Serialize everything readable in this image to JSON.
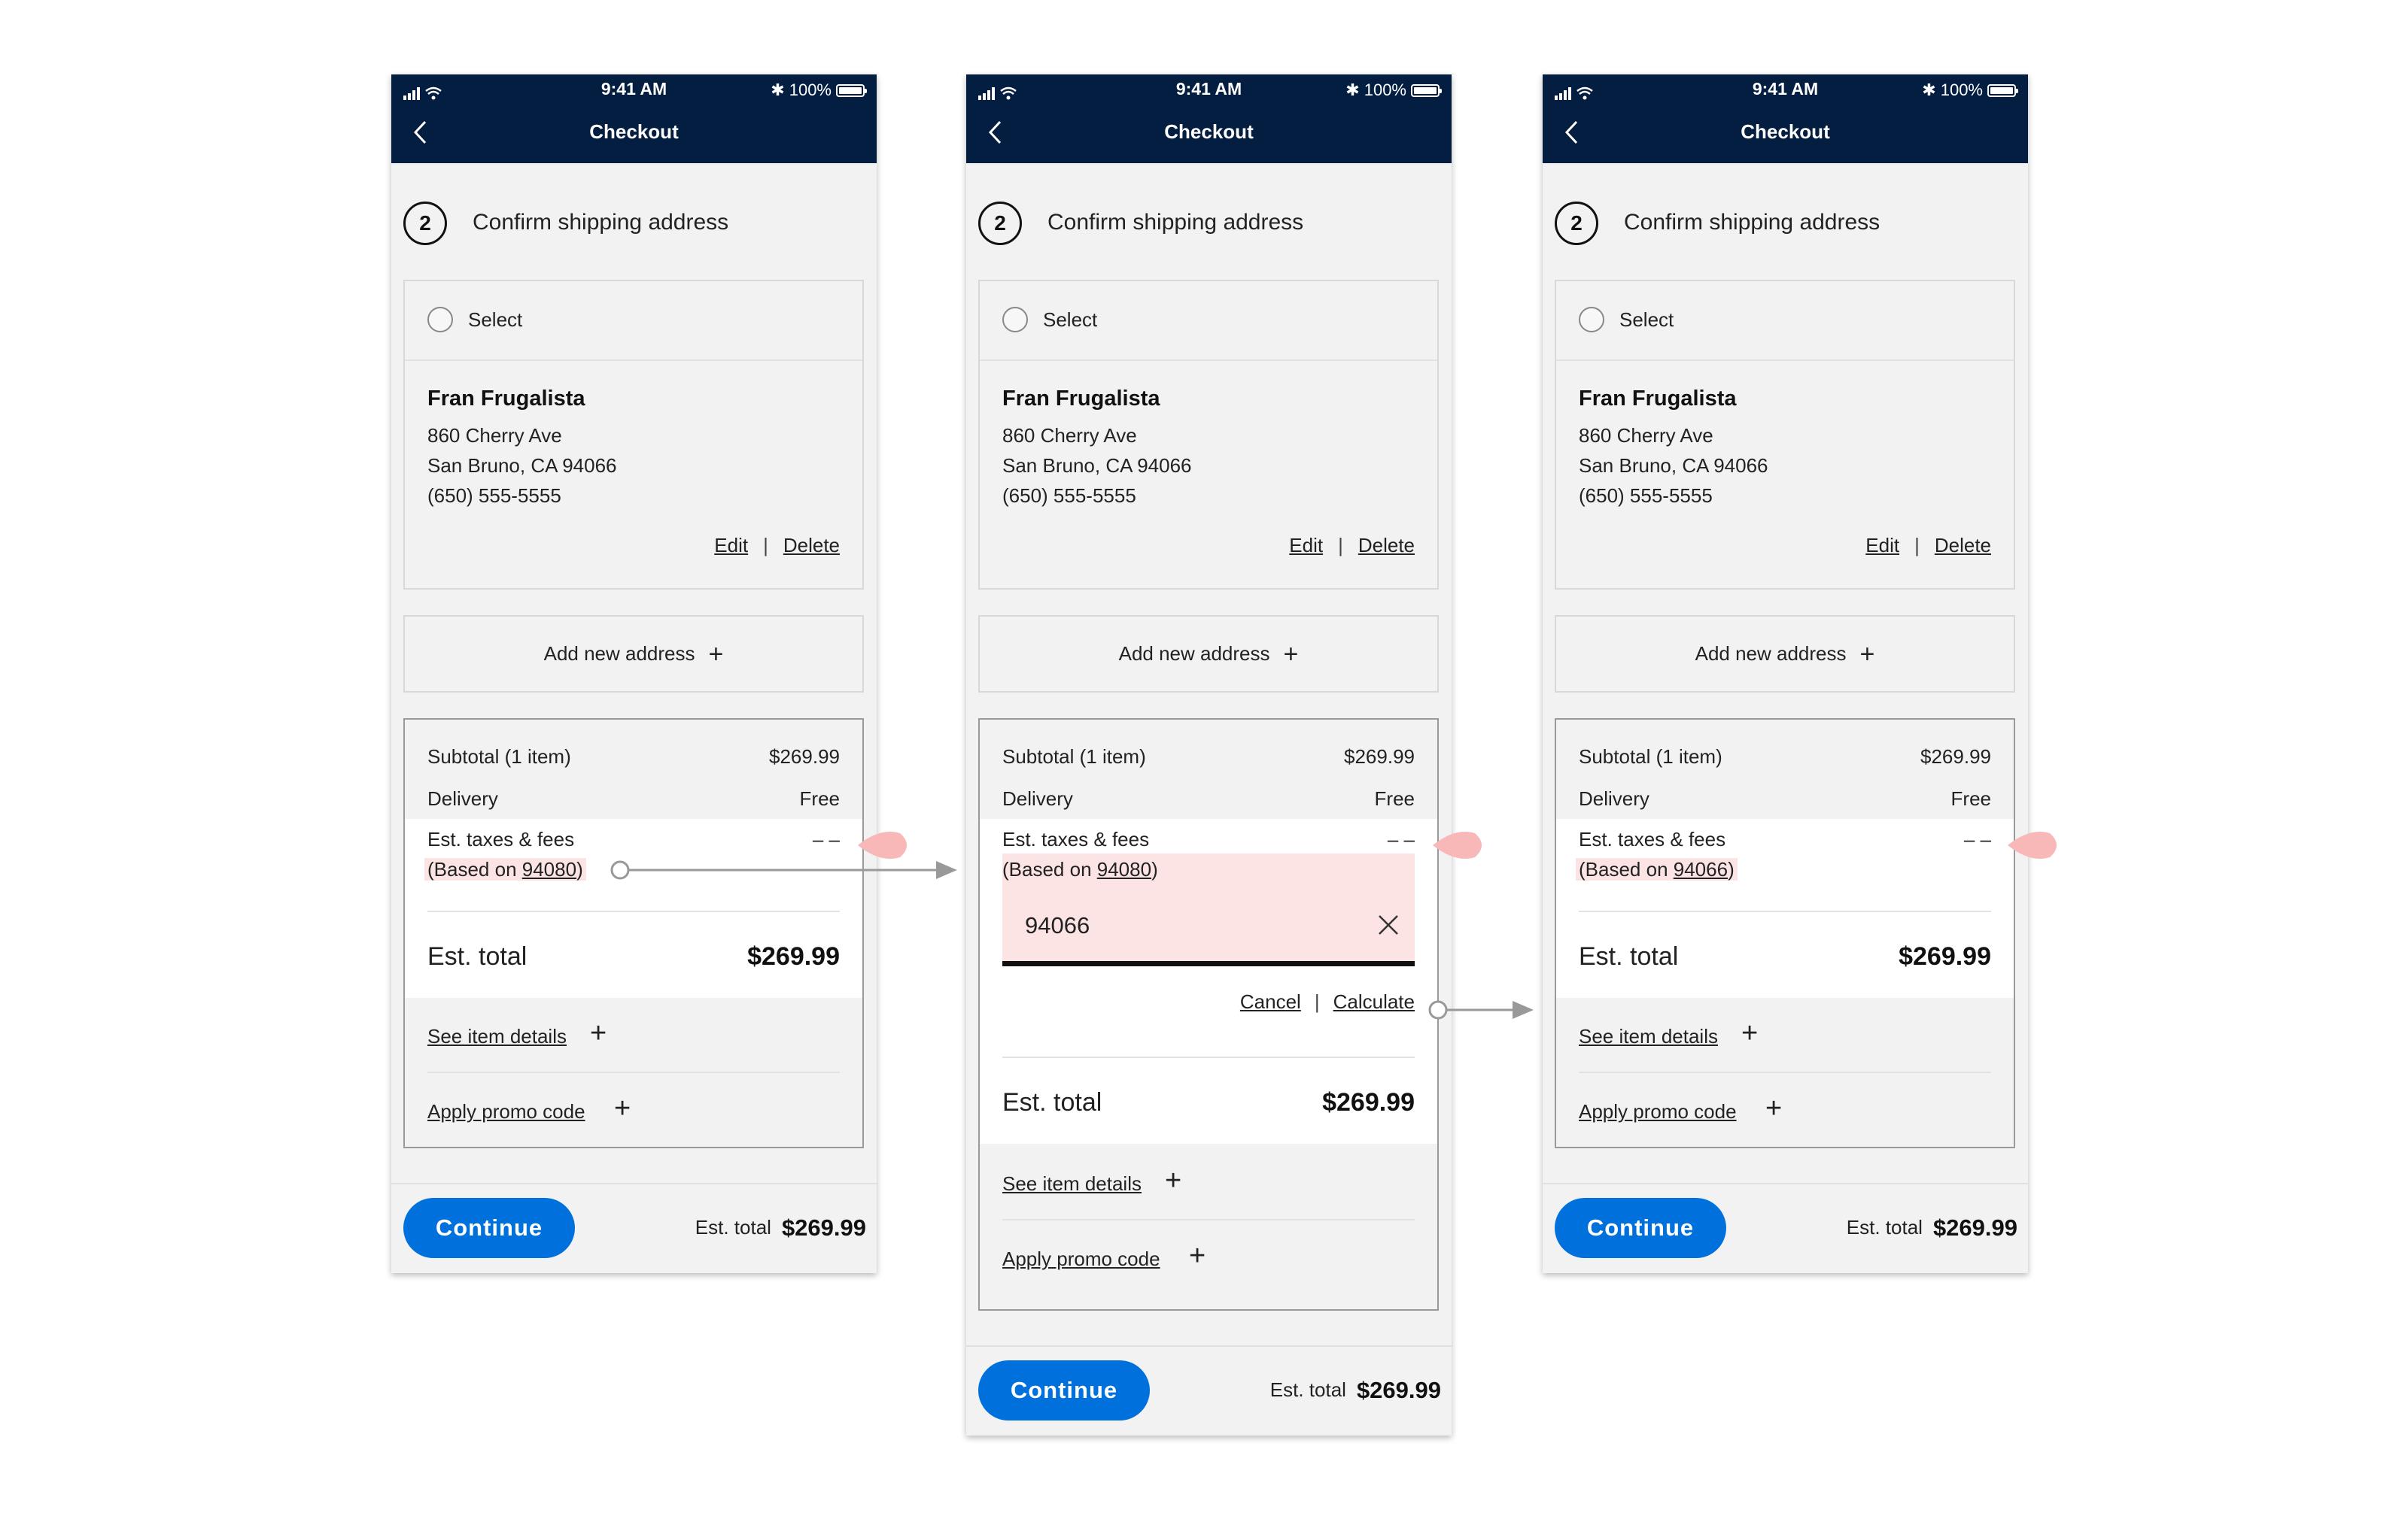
{
  "colors": {
    "nav_bg": "#041e42",
    "accent_blue": "#0071dc",
    "highlight_pink": "#fde4e4",
    "marker_pink": "#f8b8b8"
  },
  "screens": [
    {
      "status": {
        "time": "9:41 AM",
        "battery": "100%"
      },
      "nav": {
        "title": "Checkout"
      },
      "step": {
        "number": "2",
        "title": "Confirm shipping address"
      },
      "address": {
        "select_label": "Select",
        "name": "Fran Frugalista",
        "line1": "860 Cherry Ave",
        "line2": "San Bruno, CA 94066",
        "phone": "(650) 555-5555",
        "edit": "Edit",
        "separator": "|",
        "delete": "Delete"
      },
      "add_address": "Add new address",
      "summary": {
        "subtotal_label": "Subtotal (1 item)",
        "subtotal": "$269.99",
        "delivery_label": "Delivery",
        "delivery": "Free",
        "taxes_label": "Est. taxes & fees",
        "taxes": "– –",
        "based_prefix": "(Based on ",
        "based_zip": "94080",
        "based_suffix": ")",
        "total_label": "Est. total",
        "total": "$269.99",
        "see_details": "See item details",
        "promo": "Apply promo code"
      },
      "footer": {
        "button": "Continue",
        "total_label": "Est. total",
        "total": "$269.99"
      }
    },
    {
      "status": {
        "time": "9:41 AM",
        "battery": "100%"
      },
      "nav": {
        "title": "Checkout"
      },
      "step": {
        "number": "2",
        "title": "Confirm shipping address"
      },
      "address": {
        "select_label": "Select",
        "name": "Fran Frugalista",
        "line1": "860 Cherry Ave",
        "line2": "San Bruno, CA 94066",
        "phone": "(650) 555-5555",
        "edit": "Edit",
        "separator": "|",
        "delete": "Delete"
      },
      "add_address": "Add new address",
      "summary": {
        "subtotal_label": "Subtotal (1 item)",
        "subtotal": "$269.99",
        "delivery_label": "Delivery",
        "delivery": "Free",
        "taxes_label": "Est. taxes & fees",
        "taxes": "– –",
        "based_prefix": "(Based on ",
        "based_zip": "94080",
        "based_suffix": ")",
        "zip_input": "94066",
        "cancel": "Cancel",
        "calc_separator": "|",
        "calculate": "Calculate",
        "total_label": "Est. total",
        "total": "$269.99",
        "see_details": "See item details",
        "promo": "Apply promo code"
      },
      "footer": {
        "button": "Continue",
        "total_label": "Est. total",
        "total": "$269.99"
      }
    },
    {
      "status": {
        "time": "9:41 AM",
        "battery": "100%"
      },
      "nav": {
        "title": "Checkout"
      },
      "step": {
        "number": "2",
        "title": "Confirm shipping address"
      },
      "address": {
        "select_label": "Select",
        "name": "Fran Frugalista",
        "line1": "860 Cherry Ave",
        "line2": "San Bruno, CA 94066",
        "phone": "(650) 555-5555",
        "edit": "Edit",
        "separator": "|",
        "delete": "Delete"
      },
      "add_address": "Add new address",
      "summary": {
        "subtotal_label": "Subtotal (1 item)",
        "subtotal": "$269.99",
        "delivery_label": "Delivery",
        "delivery": "Free",
        "taxes_label": "Est. taxes & fees",
        "taxes": "– –",
        "based_prefix": "(Based on ",
        "based_zip": "94066",
        "based_suffix": ")",
        "total_label": "Est. total",
        "total": "$269.99",
        "see_details": "See item details",
        "promo": "Apply promo code"
      },
      "footer": {
        "button": "Continue",
        "total_label": "Est. total",
        "total": "$269.99"
      }
    }
  ]
}
